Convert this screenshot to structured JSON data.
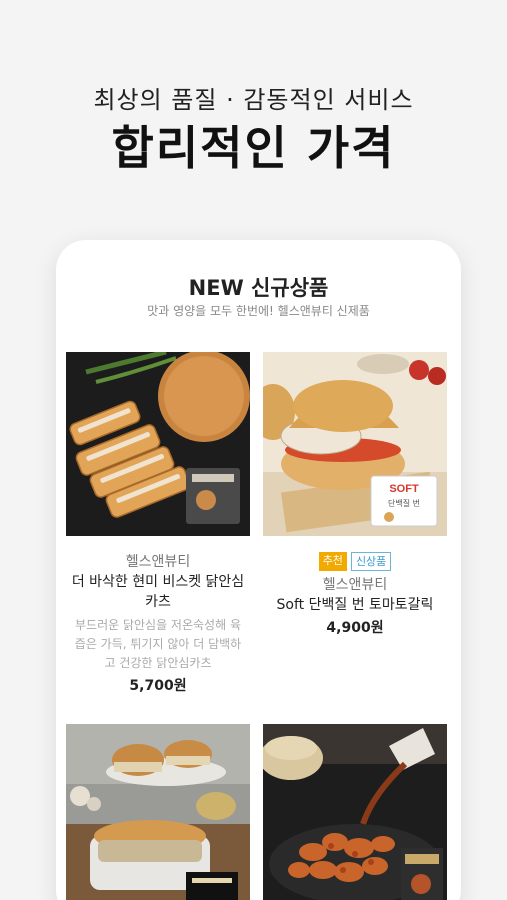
{
  "hero": {
    "subtitle": "최상의 품질 · 감동적인 서비스",
    "title": "합리적인 가격"
  },
  "section": {
    "title": "NEW 신규상품",
    "subtitle": "맛과 영양을 모두 한번에! 헬스앤뷰티 신제품"
  },
  "products": [
    {
      "brand": "헬스앤뷰티",
      "name": "더 바삭한 현미 비스켓 닭안심카츠",
      "description": "부드러운 닭안심을 저온숙성해 육즙은 가득, 튀기지 않아 더 담백하고 건강한 닭안심카츠",
      "price": "5,700원",
      "image_icon": "chicken-cutlet-photo"
    },
    {
      "badges": [
        "추천",
        "신상품"
      ],
      "brand": "헬스앤뷰티",
      "name": "Soft 단백질 번 토마토갈릭",
      "price": "4,900원",
      "image_icon": "protein-bun-photo",
      "package_label": "SOFT",
      "package_sub": "단백질 번"
    },
    {
      "image_icon": "sandwich-photo"
    },
    {
      "image_icon": "glazed-chicken-photo"
    }
  ],
  "colors": {
    "page_bg": "#f4f4f4",
    "card_bg": "#ffffff",
    "badge_recommend": "#f2a900",
    "badge_new": "#3d9ccc"
  }
}
